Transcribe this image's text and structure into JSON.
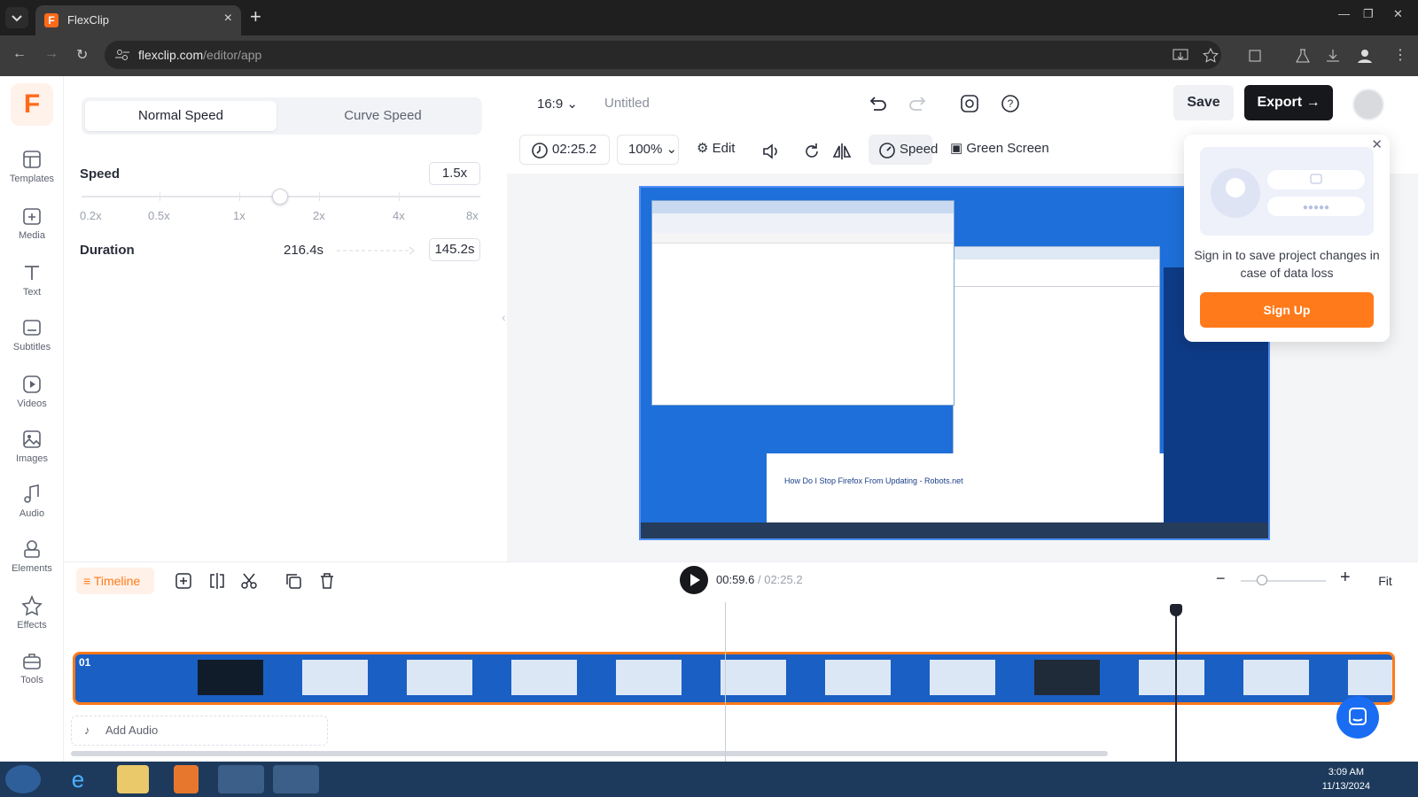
{
  "browser": {
    "tab_title": "FlexClip",
    "url_host": "flexclip.com",
    "url_path": "/editor/app"
  },
  "sidebar": {
    "logo": "F",
    "items": [
      {
        "label": "Templates",
        "icon": "templates-icon"
      },
      {
        "label": "Media",
        "icon": "media-icon"
      },
      {
        "label": "Text",
        "icon": "text-icon"
      },
      {
        "label": "Subtitles",
        "icon": "subtitles-icon"
      },
      {
        "label": "Videos",
        "icon": "videos-icon"
      },
      {
        "label": "Images",
        "icon": "images-icon"
      },
      {
        "label": "Audio",
        "icon": "audio-icon"
      },
      {
        "label": "Elements",
        "icon": "elements-icon"
      },
      {
        "label": "Effects",
        "icon": "effects-icon"
      },
      {
        "label": "Tools",
        "icon": "tools-icon"
      }
    ]
  },
  "speed_panel": {
    "tabs": [
      "Normal Speed",
      "Curve Speed"
    ],
    "active_tab": "Normal Speed",
    "speed_label": "Speed",
    "speed_value": "1.5x",
    "ticks": [
      "0.2x",
      "0.5x",
      "1x",
      "2x",
      "4x",
      "8x"
    ],
    "duration_label": "Duration",
    "duration_original": "216.4s",
    "duration_new": "145.2s"
  },
  "editor": {
    "aspect_ratio": "16:9",
    "title": "Untitled",
    "save_label": "Save",
    "export_label": "Export"
  },
  "toolbar": {
    "duration": "02:25.2",
    "zoom": "100%",
    "edit_label": "Edit",
    "speed_label": "Speed",
    "green_screen_label": "Green Screen"
  },
  "popup": {
    "message": "Sign in to save project changes in case of data loss",
    "signup_label": "Sign Up"
  },
  "timeline": {
    "label": "Timeline",
    "current_time": "00:59.6",
    "total_time": "/ 02:25.2",
    "fit_label": "Fit",
    "clip_number": "01",
    "add_audio_label": "Add Audio"
  },
  "preview": {
    "search_title": "How Do I Stop Firefox From Updating - Robots.net"
  },
  "taskbar": {
    "time": "3:09 AM",
    "date": "11/13/2024"
  },
  "colors": {
    "accent": "#ff7a1a",
    "dark": "#17181c",
    "preview_bg": "#1e6fd9"
  }
}
